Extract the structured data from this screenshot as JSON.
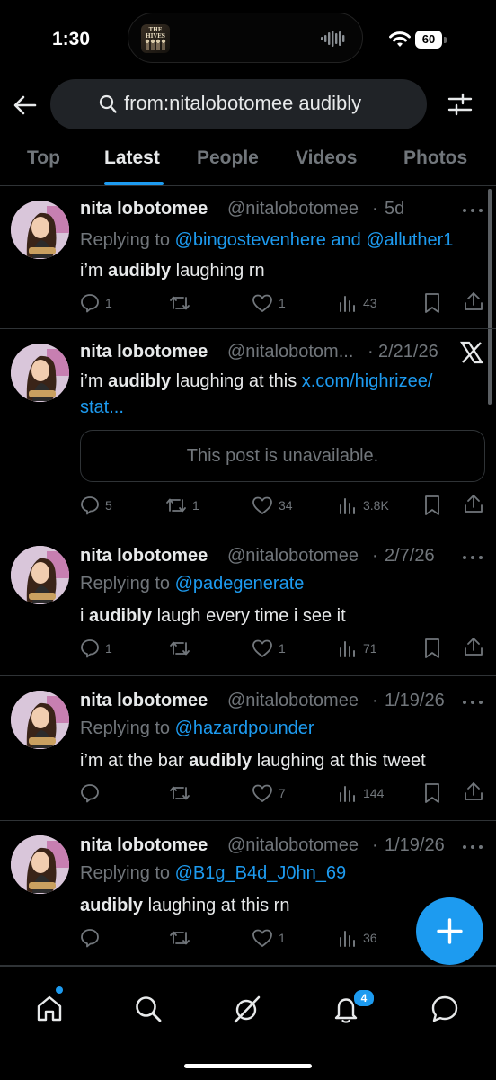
{
  "status_bar": {
    "time": "1:30",
    "battery": "60",
    "now_playing_art_text": "THE HIVES"
  },
  "search": {
    "query": "from:nitalobotomee audibly"
  },
  "tabs": [
    {
      "label": "Top"
    },
    {
      "label": "Latest",
      "active": true
    },
    {
      "label": "People"
    },
    {
      "label": "Videos"
    },
    {
      "label": "Photos"
    }
  ],
  "posts": [
    {
      "name": "nita lobotomee",
      "handle": "@nitalobotomee",
      "sep": "·",
      "time": "5d",
      "replying_prefix": "Replying to",
      "replying_to_1": "@bingostevenhere",
      "replying_and": "and",
      "replying_to_2": "@alluther1",
      "text_before": "i’m ",
      "text_bold": "audibly",
      "text_after": " laughing rn",
      "replies": "1",
      "reposts": "",
      "likes": "1",
      "views": "43"
    },
    {
      "name": "nita lobotomee",
      "handle": "@nitalobotom...",
      "sep": "·",
      "time": "2/21/26",
      "text_before": "i’m ",
      "text_bold": "audibly",
      "text_after": " laughing at this ",
      "link_line1": "x.com/highrizee/",
      "link_line2": "stat...",
      "unavailable": "This post is unavailable.",
      "replies": "5",
      "reposts": "1",
      "likes": "34",
      "views": "3.8K"
    },
    {
      "name": "nita lobotomee",
      "handle": "@nitalobotomee",
      "sep": "·",
      "time": "2/7/26",
      "replying_prefix": "Replying to",
      "replying_to_1": "@padegenerate",
      "text_before": "i ",
      "text_bold": "audibly",
      "text_after": " laugh every time i see it",
      "replies": "1",
      "reposts": "",
      "likes": "1",
      "views": "71"
    },
    {
      "name": "nita lobotomee",
      "handle": "@nitalobotomee",
      "sep": "·",
      "time": "1/19/26",
      "replying_prefix": "Replying to",
      "replying_to_1": "@hazardpounder",
      "text_before": "i’m at the bar ",
      "text_bold": "audibly",
      "text_after": " laughing at this tweet",
      "replies": "",
      "reposts": "",
      "likes": "7",
      "views": "144"
    },
    {
      "name": "nita lobotomee",
      "handle": "@nitalobotomee",
      "sep": "·",
      "time": "1/19/26",
      "replying_prefix": "Replying to",
      "replying_to_1": "@B1g_B4d_J0hn_69",
      "text_before": "",
      "text_bold": "audibly",
      "text_after": " laughing at this rn",
      "replies": "",
      "reposts": "",
      "likes": "1",
      "views": "36"
    }
  ],
  "bottom_nav": {
    "items": [
      {
        "icon": "home-icon"
      },
      {
        "icon": "search-icon"
      },
      {
        "icon": "grok-icon"
      },
      {
        "icon": "bell-icon"
      },
      {
        "icon": "chat-icon"
      }
    ],
    "notifications_badge": "4"
  },
  "colors": {
    "accent": "#1d9bf0",
    "background": "#000000",
    "muted": "#71767b",
    "text": "#e7e9ea"
  }
}
